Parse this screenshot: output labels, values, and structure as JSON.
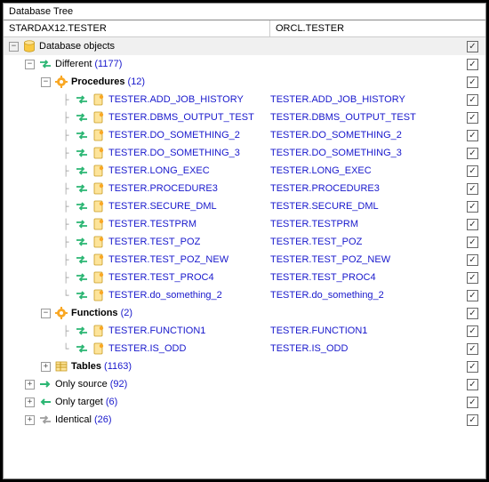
{
  "title": "Database Tree",
  "headers": {
    "left": "STARDAX12.TESTER",
    "right": "ORCL.TESTER"
  },
  "checkmark": "✓",
  "nodes": [
    {
      "depth": 0,
      "exp": "minus",
      "icon": "db",
      "label": "Database objects",
      "checked": true,
      "root": true
    },
    {
      "depth": 1,
      "exp": "minus",
      "icon": "diff",
      "label": "Different",
      "count": "(1177)",
      "checked": true
    },
    {
      "depth": 2,
      "exp": "minus",
      "icon": "gear",
      "label": "Procedures",
      "count": "(12)",
      "bold": true,
      "checked": true
    },
    {
      "depth": 3,
      "icon": "diff",
      "icon2": "doc",
      "link": "TESTER.ADD_JOB_HISTORY",
      "right": "TESTER.ADD_JOB_HISTORY",
      "checked": true
    },
    {
      "depth": 3,
      "icon": "diff",
      "icon2": "doc",
      "link": "TESTER.DBMS_OUTPUT_TEST",
      "right": "TESTER.DBMS_OUTPUT_TEST",
      "checked": true
    },
    {
      "depth": 3,
      "icon": "diff",
      "icon2": "doc",
      "link": "TESTER.DO_SOMETHING_2",
      "right": "TESTER.DO_SOMETHING_2",
      "checked": true
    },
    {
      "depth": 3,
      "icon": "diff",
      "icon2": "doc",
      "link": "TESTER.DO_SOMETHING_3",
      "right": "TESTER.DO_SOMETHING_3",
      "checked": true
    },
    {
      "depth": 3,
      "icon": "diff",
      "icon2": "doc",
      "link": "TESTER.LONG_EXEC",
      "right": "TESTER.LONG_EXEC",
      "checked": true
    },
    {
      "depth": 3,
      "icon": "diff",
      "icon2": "doc",
      "link": "TESTER.PROCEDURE3",
      "right": "TESTER.PROCEDURE3",
      "checked": true
    },
    {
      "depth": 3,
      "icon": "diff",
      "icon2": "doc",
      "link": "TESTER.SECURE_DML",
      "right": "TESTER.SECURE_DML",
      "checked": true
    },
    {
      "depth": 3,
      "icon": "diff",
      "icon2": "doc",
      "link": "TESTER.TESTPRM",
      "right": "TESTER.TESTPRM",
      "checked": true
    },
    {
      "depth": 3,
      "icon": "diff",
      "icon2": "doc",
      "link": "TESTER.TEST_POZ",
      "right": "TESTER.TEST_POZ",
      "checked": true
    },
    {
      "depth": 3,
      "icon": "diff",
      "icon2": "doc",
      "link": "TESTER.TEST_POZ_NEW",
      "right": "TESTER.TEST_POZ_NEW",
      "checked": true
    },
    {
      "depth": 3,
      "icon": "diff",
      "icon2": "doc",
      "link": "TESTER.TEST_PROC4",
      "right": "TESTER.TEST_PROC4",
      "checked": true
    },
    {
      "depth": 3,
      "icon": "diff",
      "icon2": "doc",
      "link": "TESTER.do_something_2",
      "right": "TESTER.do_something_2",
      "checked": true,
      "last": true
    },
    {
      "depth": 2,
      "exp": "minus",
      "icon": "gear",
      "label": "Functions",
      "count": "(2)",
      "bold": true,
      "checked": true
    },
    {
      "depth": 3,
      "icon": "diff",
      "icon2": "doc",
      "link": "TESTER.FUNCTION1",
      "right": "TESTER.FUNCTION1",
      "checked": true
    },
    {
      "depth": 3,
      "icon": "diff",
      "icon2": "doc",
      "link": "TESTER.IS_ODD",
      "right": "TESTER.IS_ODD",
      "checked": true,
      "last": true
    },
    {
      "depth": 2,
      "exp": "plus",
      "icon": "tables",
      "label": "Tables",
      "count": "(1163)",
      "bold": true,
      "checked": true
    },
    {
      "depth": 1,
      "exp": "plus",
      "icon": "src",
      "label": "Only source",
      "count": "(92)",
      "checked": true
    },
    {
      "depth": 1,
      "exp": "plus",
      "icon": "tgt",
      "label": "Only target",
      "count": "(6)",
      "checked": true
    },
    {
      "depth": 1,
      "exp": "plus",
      "icon": "eq",
      "label": "Identical",
      "count": "(26)",
      "checked": true
    }
  ]
}
